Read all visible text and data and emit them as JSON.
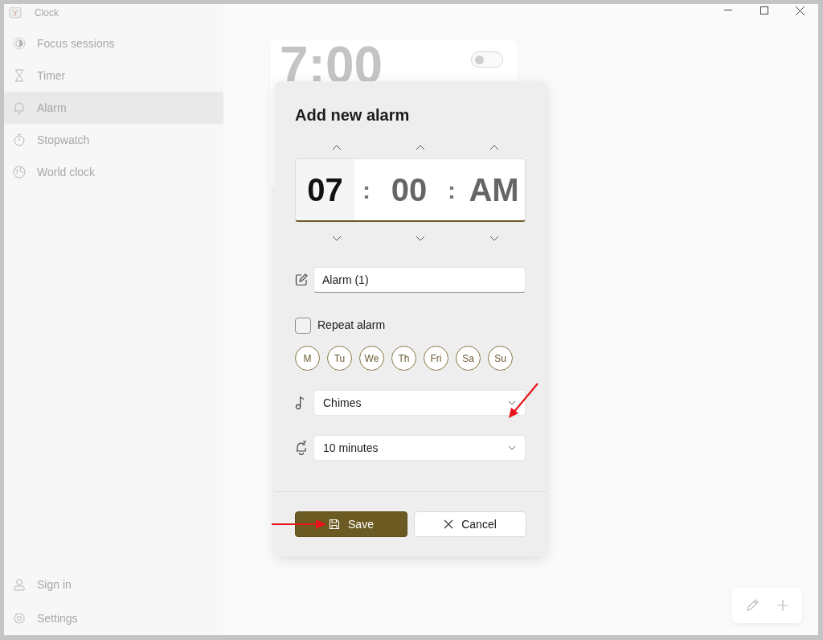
{
  "window": {
    "title": "Clock"
  },
  "sidebar": {
    "items": [
      {
        "label": "Focus sessions",
        "kind": "focus",
        "selected": false
      },
      {
        "label": "Timer",
        "kind": "timer",
        "selected": false
      },
      {
        "label": "Alarm",
        "kind": "alarm",
        "selected": true
      },
      {
        "label": "Stopwatch",
        "kind": "stopwatch",
        "selected": false
      },
      {
        "label": "World clock",
        "kind": "world",
        "selected": false
      }
    ],
    "footer_items": [
      {
        "label": "Sign in",
        "kind": "user"
      },
      {
        "label": "Settings",
        "kind": "settings"
      }
    ]
  },
  "alarm_card": {
    "time": "7:00",
    "on": false
  },
  "dialog": {
    "title": "Add new alarm",
    "time_picker": {
      "columns": [
        {
          "value": "07",
          "selected": true
        },
        {
          "value": "00",
          "selected": false
        },
        {
          "value": "AM",
          "selected": false
        }
      ],
      "separators": [
        ":",
        ":"
      ]
    },
    "name_field": {
      "value": "Alarm (1)"
    },
    "repeat": {
      "label": "Repeat alarm",
      "checked": false
    },
    "days": [
      {
        "label": "M",
        "selected": false
      },
      {
        "label": "Tu",
        "selected": false
      },
      {
        "label": "We",
        "selected": false
      },
      {
        "label": "Th",
        "selected": false
      },
      {
        "label": "Fri",
        "selected": false
      },
      {
        "label": "Sa",
        "selected": false
      },
      {
        "label": "Su",
        "selected": false
      }
    ],
    "sound": {
      "value": "Chimes"
    },
    "snooze": {
      "value": "10 minutes"
    },
    "buttons": [
      {
        "label": "Save",
        "kind": "primary"
      },
      {
        "label": "Cancel",
        "kind": "secondary"
      }
    ]
  }
}
